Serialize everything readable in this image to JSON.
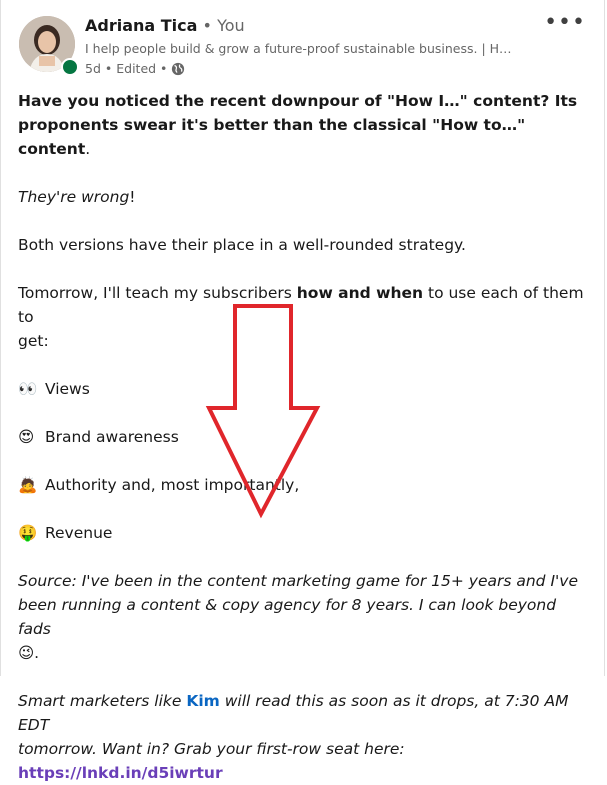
{
  "author": {
    "name": "Adriana Tica",
    "relation": "• You",
    "headline": "I help people build & grow a future-proof sustainable business. | H…",
    "time": "5d",
    "edited": "• Edited •"
  },
  "post": {
    "intro_1": "Have you noticed the recent downpour of \"How I…\" content? Its",
    "intro_2": "proponents swear it's better than the classical \"How to…\" content",
    "intro_end": ".",
    "wrong": "They're wrong",
    "wrong_end": "!",
    "versions": "Both versions have their place in a well-rounded strategy.",
    "tomorrow_pre": "Tomorrow, I'll teach my subscribers ",
    "tomorrow_bold": "how and when",
    "tomorrow_post": " to use each of them to",
    "tomorrow_end": "get:",
    "list": [
      {
        "emoji": "👀",
        "text": "Views"
      },
      {
        "emoji": "😍",
        "text": "Brand awareness"
      },
      {
        "emoji": "🙇",
        "text": "Authority and, most importantly,"
      },
      {
        "emoji": "🤑",
        "text": "Revenue"
      }
    ],
    "source_1": "Source: I've been in the content marketing game for 15+ years and I've",
    "source_2": "been running a content & copy agency for 8 years. I can look beyond fads",
    "source_emoji": "😉",
    "source_end": ".",
    "smart_pre": "Smart marketers like ",
    "smart_link": "Kim",
    "smart_post": " will read this as soon as it drops, at 7:30 AM EDT",
    "smart_2": "tomorrow. Want in? Grab your first-row seat here: ",
    "smart_url": "https://lnkd.in/d5iwrtur"
  },
  "colors": {
    "link": "#0a66c2",
    "url": "#6a3fb8",
    "arrow": "#e0262b",
    "presence": "#057642"
  }
}
